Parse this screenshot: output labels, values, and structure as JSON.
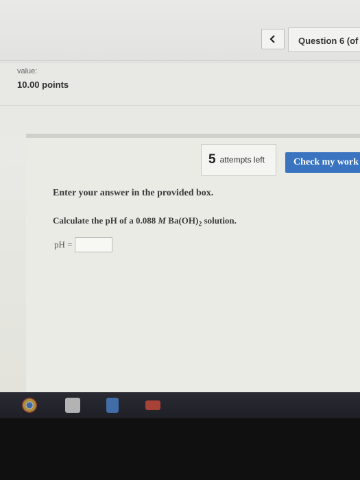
{
  "header": {
    "question_label": "Question 6 (of"
  },
  "score": {
    "value_label": "value:",
    "points": "10.00 points"
  },
  "attempts": {
    "count": "5",
    "text": "attempts left"
  },
  "actions": {
    "check_label": "Check my work"
  },
  "question": {
    "instruction": "Enter your answer in the provided box.",
    "prompt_prefix": "Calculate the pH of a 0.088 ",
    "prompt_unit": "M",
    "prompt_compound": " Ba(OH)",
    "prompt_subscript": "2",
    "prompt_suffix": " solution.",
    "answer_label": "pH =",
    "answer_value": ""
  },
  "taskbar": {
    "icons": [
      "chrome-icon",
      "gmail-icon",
      "docs-icon",
      "youtube-icon"
    ]
  },
  "colors": {
    "check_button": "#3a74c0",
    "taskbar": "#24242c"
  }
}
